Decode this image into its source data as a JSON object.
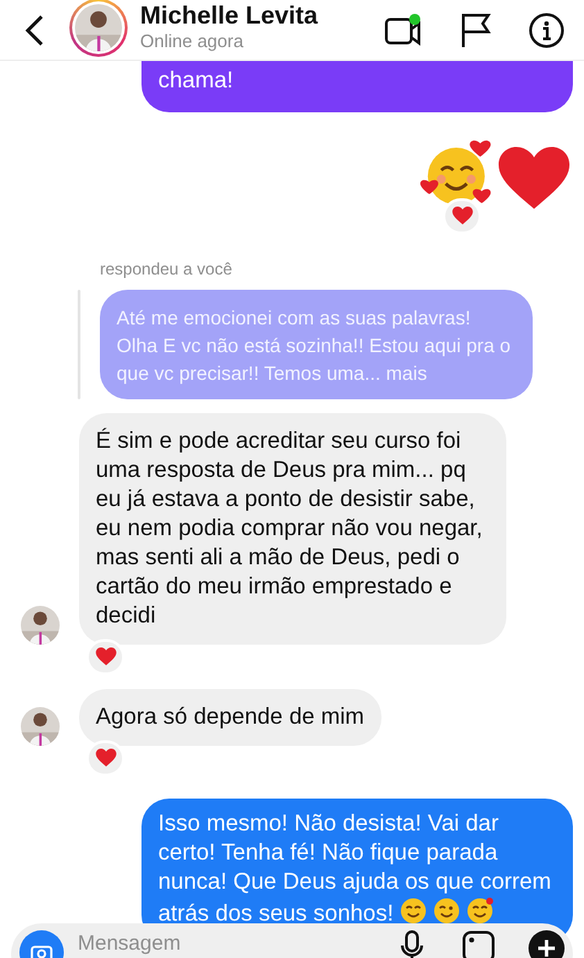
{
  "header": {
    "name": "Michelle Levita",
    "status": "Online agora",
    "video_active": true
  },
  "messages": [
    {
      "kind": "sent",
      "text": "chama!",
      "color": "#7a3cf7"
    },
    {
      "kind": "emoji",
      "reaction": true
    },
    {
      "kind": "reply",
      "label": "respondeu a você",
      "text": "Até me emocionei com as suas palavras! Olha E vc não está sozinha!! Estou aqui pra o que vc precisar!! Temos uma... mais"
    },
    {
      "kind": "received",
      "text": "É sim e pode acreditar seu curso foi uma resposta de Deus pra mim... pq eu já estava a ponto de desistir sabe, eu nem podia comprar não vou negar, mas senti ali a mão de Deus, pedi o cartão do meu irmão emprestado e decidi",
      "reaction": true
    },
    {
      "kind": "received",
      "text": "Agora só depende de mim",
      "reaction": true
    },
    {
      "kind": "sent",
      "text": "Isso mesmo! Não desista! Vai dar certo! Tenha fé! Não fique parada nunca! Que Deus ajuda os que correm atrás dos seus sonhos!",
      "color": "#1f7cf6",
      "emojis": true
    }
  ],
  "composer": {
    "placeholder": "Mensagem"
  }
}
